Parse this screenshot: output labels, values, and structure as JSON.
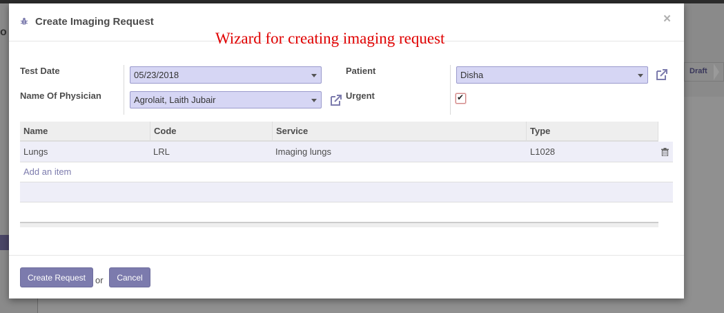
{
  "background": {
    "status_label": "Draft",
    "left_stub": "o"
  },
  "modal": {
    "title": "Create Imaging Request",
    "close_glyph": "×",
    "annotation": "Wizard for creating imaging request"
  },
  "form": {
    "test_date_label": "Test Date",
    "test_date_value": "05/23/2018",
    "physician_label": "Name Of Physician",
    "physician_value": "Agrolait, Laith Jubair",
    "patient_label": "Patient",
    "patient_value": "Disha",
    "urgent_label": "Urgent",
    "urgent_checked": true,
    "urgent_glyph": "✔"
  },
  "table": {
    "headers": [
      "Name",
      "Code",
      "Service",
      "Type"
    ],
    "rows": [
      [
        "Lungs",
        "LRL",
        "Imaging lungs",
        "L1028"
      ]
    ],
    "add_item_label": "Add an item"
  },
  "footer": {
    "create_label": "Create Request",
    "or_label": "or",
    "cancel_label": "Cancel"
  },
  "colors": {
    "accent": "#7c7bad",
    "annotation": "#e00000",
    "select_bg": "#d6d6f4"
  }
}
